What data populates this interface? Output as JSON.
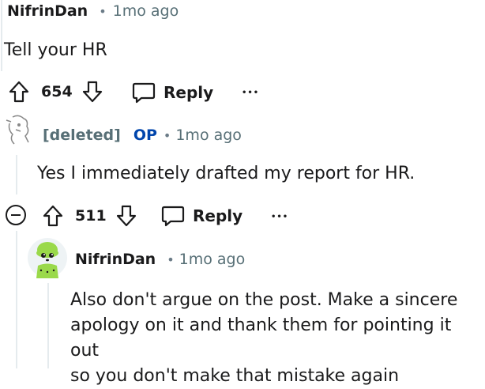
{
  "comments": [
    {
      "author": "NifrinDan",
      "separator": "•",
      "time": "1mo ago",
      "text": "Tell your HR",
      "score": "654",
      "reply_label": "Reply",
      "more_label": "•••"
    },
    {
      "author": "[deleted]",
      "op_badge": "OP",
      "separator": "•",
      "time": "1mo ago",
      "text": "Yes I immediately drafted my report for HR.",
      "score": "511",
      "reply_label": "Reply",
      "more_label": "•••"
    },
    {
      "author": "NifrinDan",
      "separator": "•",
      "time": "1mo ago",
      "text_lines": [
        "Also don't argue on the post. Make a sincere",
        "apology on it and thank them for pointing it out",
        "so you don't make that mistake again"
      ]
    }
  ],
  "icons": {
    "upvote": "arrow-up-icon",
    "downvote": "arrow-down-icon",
    "reply": "speech-bubble-icon",
    "collapse": "minus-circle-icon",
    "more": "ellipsis-icon"
  },
  "colors": {
    "text": "#1a1a1b",
    "muted": "#576f76",
    "op": "#0045ac",
    "thread_line": "#e5ebee",
    "avatar_green": "#9ad94a"
  }
}
